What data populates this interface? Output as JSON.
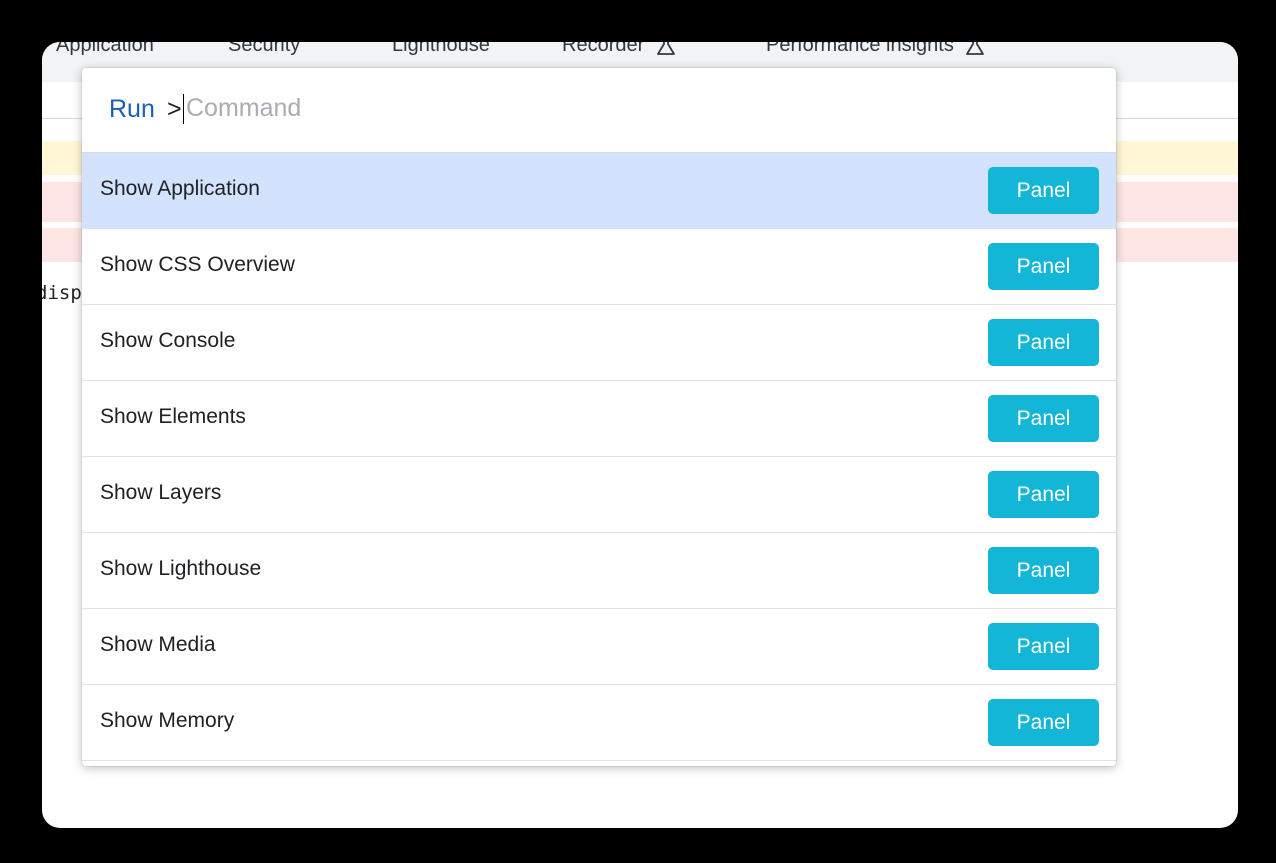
{
  "devtools": {
    "tabs": [
      {
        "label": "Application",
        "experimental": false
      },
      {
        "label": "Security",
        "experimental": false
      },
      {
        "label": "Lighthouse",
        "experimental": false
      },
      {
        "label": "Recorder",
        "experimental": true
      },
      {
        "label": "Performance insights",
        "experimental": true
      }
    ],
    "background_code": "disp"
  },
  "command_menu": {
    "prefix_label": "Run",
    "prompt_symbol": ">",
    "input_value": "",
    "input_placeholder": "Command",
    "items": [
      {
        "label": "Show Application",
        "badge": "Panel",
        "selected": true
      },
      {
        "label": "Show CSS Overview",
        "badge": "Panel",
        "selected": false
      },
      {
        "label": "Show Console",
        "badge": "Panel",
        "selected": false
      },
      {
        "label": "Show Elements",
        "badge": "Panel",
        "selected": false
      },
      {
        "label": "Show Layers",
        "badge": "Panel",
        "selected": false
      },
      {
        "label": "Show Lighthouse",
        "badge": "Panel",
        "selected": false
      },
      {
        "label": "Show Media",
        "badge": "Panel",
        "selected": false
      },
      {
        "label": "Show Memory",
        "badge": "Panel",
        "selected": false
      }
    ]
  },
  "colors": {
    "badge": "#13b6d6",
    "selected_row": "#d3e3fd",
    "prefix": "#1a5fb4"
  }
}
